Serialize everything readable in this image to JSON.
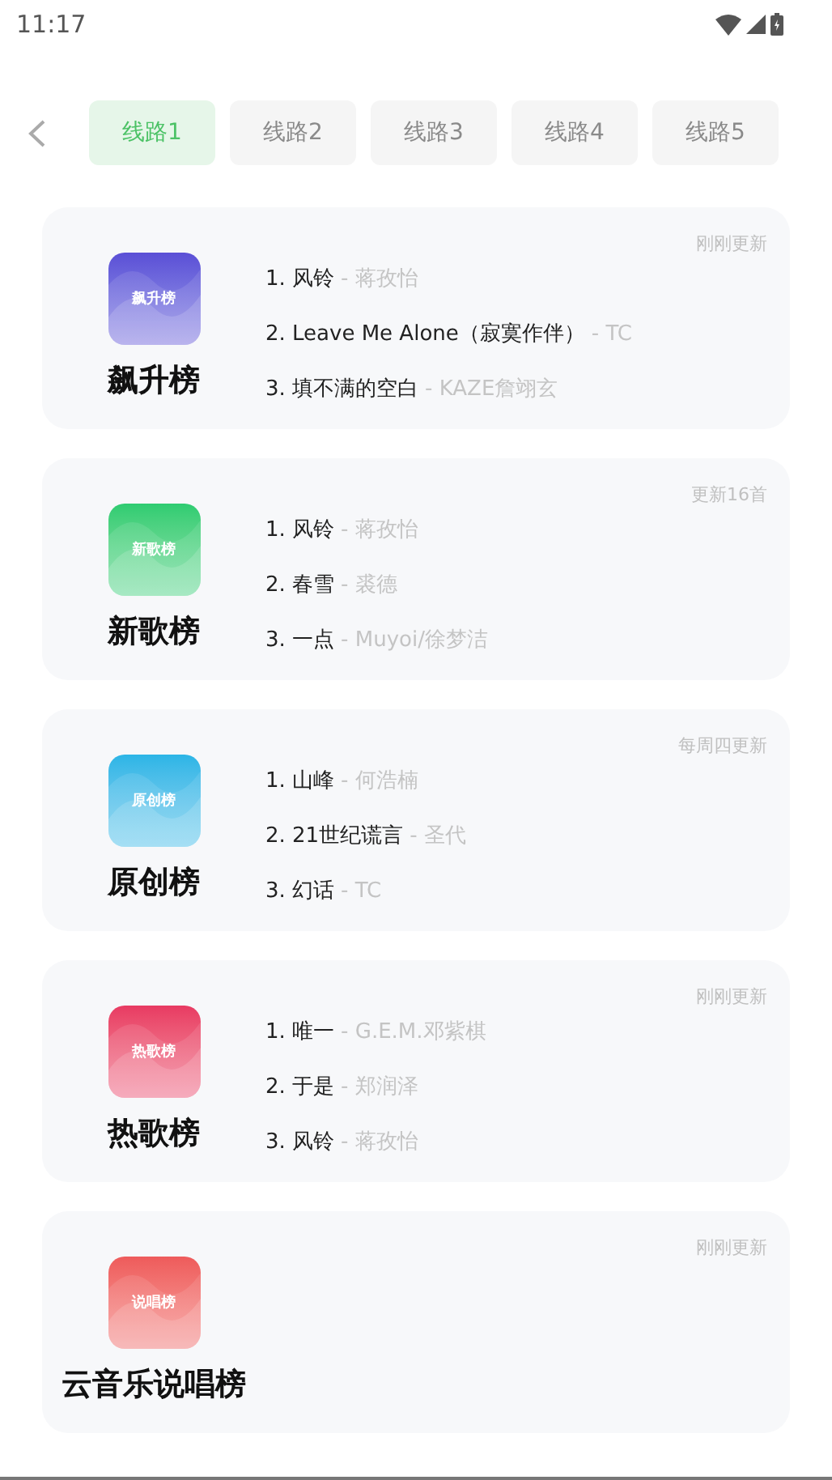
{
  "status_bar": {
    "time": "11:17"
  },
  "tabs": [
    {
      "label": "线路1",
      "selected": true
    },
    {
      "label": "线路2",
      "selected": false
    },
    {
      "label": "线路3",
      "selected": false
    },
    {
      "label": "线路4",
      "selected": false
    },
    {
      "label": "线路5",
      "selected": false
    }
  ],
  "charts": [
    {
      "title": "飙升榜",
      "cover_label": "飙升榜",
      "color": "#5b4fd6",
      "update": "刚刚更新",
      "songs": [
        {
          "title": "1. 风铃",
          "artist": "- 蒋孜怡"
        },
        {
          "title": "2. Leave Me Alone（寂寞作伴）",
          "artist": "- TC"
        },
        {
          "title": "3. 填不满的空白",
          "artist": "- KAZE詹翊玄"
        }
      ]
    },
    {
      "title": "新歌榜",
      "cover_label": "新歌榜",
      "color": "#2ecc71",
      "update": "更新16首",
      "songs": [
        {
          "title": "1. 风铃",
          "artist": "- 蒋孜怡"
        },
        {
          "title": "2. 春雪",
          "artist": "- 裘德"
        },
        {
          "title": "3. 一点",
          "artist": "- Muyoi/徐梦洁"
        }
      ]
    },
    {
      "title": "原创榜",
      "cover_label": "原创榜",
      "color": "#2bb5e6",
      "update": "每周四更新",
      "songs": [
        {
          "title": "1. 山峰",
          "artist": "- 何浩楠"
        },
        {
          "title": "2. 21世纪谎言",
          "artist": "- 圣代"
        },
        {
          "title": "3. 幻话",
          "artist": "- TC"
        }
      ]
    },
    {
      "title": "热歌榜",
      "cover_label": "热歌榜",
      "color": "#e83a62",
      "update": "刚刚更新",
      "songs": [
        {
          "title": "1. 唯一",
          "artist": "- G.E.M.邓紫棋"
        },
        {
          "title": "2. 于是",
          "artist": "- 郑润泽"
        },
        {
          "title": "3. 风铃",
          "artist": "- 蒋孜怡"
        }
      ]
    },
    {
      "title": "云音乐说唱榜",
      "cover_label": "说唱榜",
      "color": "#ee5b5b",
      "update": "刚刚更新"
    }
  ]
}
